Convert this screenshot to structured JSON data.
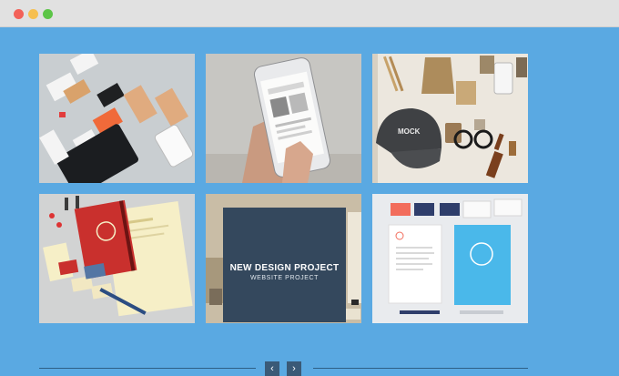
{
  "window": {
    "controls": [
      "close",
      "minimize",
      "maximize"
    ]
  },
  "colors": {
    "background": "#5aa9e2",
    "titlebar": "#e1e1e1",
    "overlay": "#34485d"
  },
  "portfolio": {
    "items": [
      {
        "name": "stationery-tags-mockup"
      },
      {
        "name": "phone-in-hand-mockup"
      },
      {
        "name": "packaging-cap-mockup"
      },
      {
        "name": "red-notebook-stationery-mockup"
      },
      {
        "name": "brand-papers-mockup",
        "overlay_title": "NEW DESIGN PROJECT",
        "overlay_subtitle": "WEBSITE PROJECT"
      },
      {
        "name": "blue-folder-stationery-mockup"
      }
    ]
  },
  "pager": {
    "prev_icon": "chevron-left-icon",
    "next_icon": "chevron-right-icon",
    "prev_glyph": "‹",
    "next_glyph": "›"
  }
}
